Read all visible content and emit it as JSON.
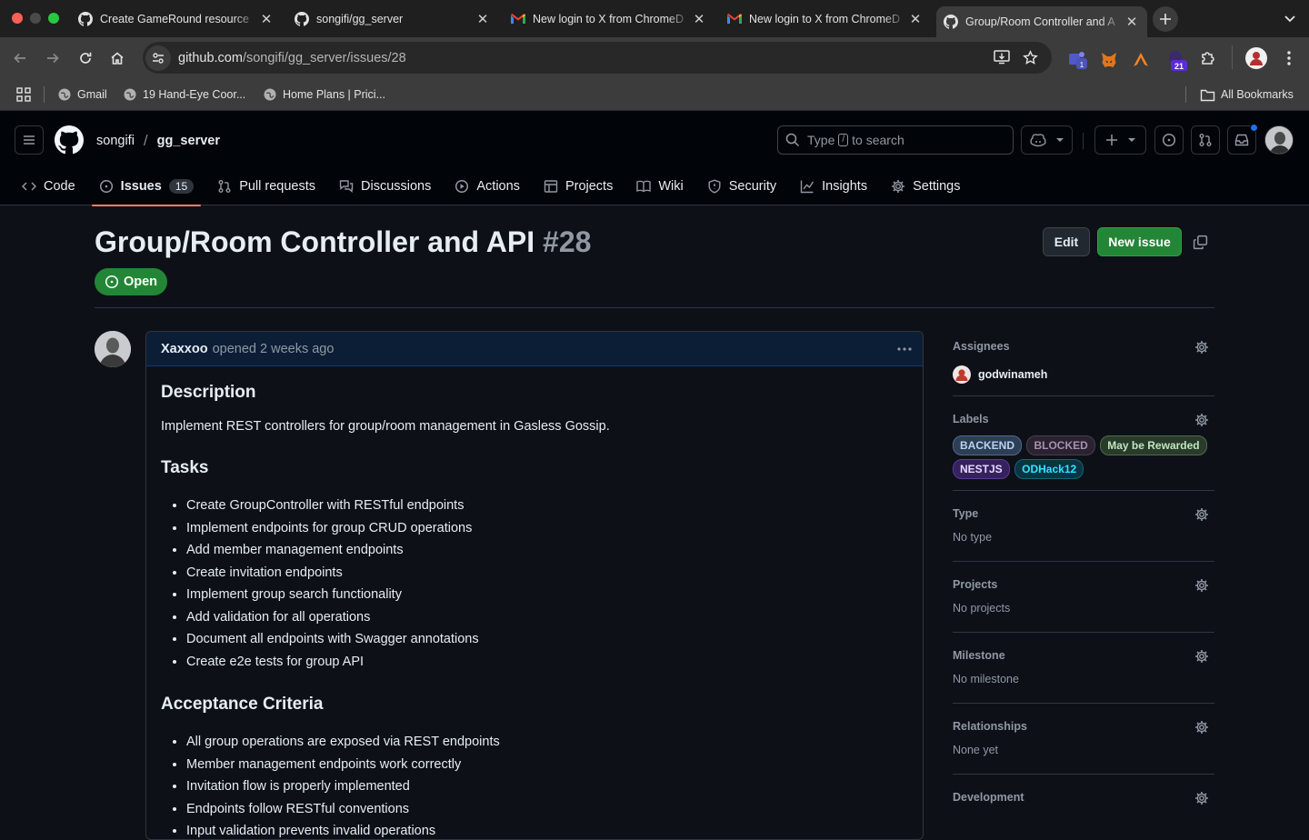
{
  "browser": {
    "tabs": [
      {
        "title": "Create GameRound resource",
        "icon": "github-icon"
      },
      {
        "title": "songifi/gg_server",
        "icon": "github-icon"
      },
      {
        "title": "New login to X from ChromeD",
        "icon": "gmail-icon"
      },
      {
        "title": "New login to X from ChromeD",
        "icon": "gmail-icon"
      },
      {
        "title": "Group/Room Controller and A",
        "icon": "github-icon",
        "active": true
      }
    ],
    "url_host": "github.com",
    "url_path": "/songifi/gg_server/issues/28",
    "extension_badges": {
      "teams": "1",
      "ext": "21"
    },
    "bookmarks": [
      {
        "label": "Gmail",
        "icon": "gmail-icon"
      },
      {
        "label": "19 Hand-Eye Coor...",
        "icon": "globe-icon"
      },
      {
        "label": "Home Plans | Prici...",
        "icon": "globe-icon"
      }
    ],
    "all_bookmarks": "All Bookmarks"
  },
  "repo": {
    "owner": "songifi",
    "separator": "/",
    "name": "gg_server"
  },
  "search": {
    "prefix": "Type",
    "kbd": "/",
    "suffix": "to search"
  },
  "nav": [
    {
      "label": "Code",
      "icon": "code-icon"
    },
    {
      "label": "Issues",
      "icon": "issue-opened-icon",
      "counter": "15",
      "selected": true
    },
    {
      "label": "Pull requests",
      "icon": "git-pull-request-icon"
    },
    {
      "label": "Discussions",
      "icon": "comment-discussion-icon"
    },
    {
      "label": "Actions",
      "icon": "play-icon"
    },
    {
      "label": "Projects",
      "icon": "table-icon"
    },
    {
      "label": "Wiki",
      "icon": "book-icon"
    },
    {
      "label": "Security",
      "icon": "shield-icon"
    },
    {
      "label": "Insights",
      "icon": "graph-icon"
    },
    {
      "label": "Settings",
      "icon": "gear-icon"
    }
  ],
  "issue": {
    "title": "Group/Room Controller and API",
    "number": "#28",
    "state": "Open",
    "edit_label": "Edit",
    "new_issue_label": "New issue",
    "author": "Xaxxoo",
    "opened_text": "opened 2 weeks ago",
    "body": {
      "h_description": "Description",
      "description": "Implement REST controllers for group/room management in Gasless Gossip.",
      "h_tasks": "Tasks",
      "tasks": [
        "Create GroupController with RESTful endpoints",
        "Implement endpoints for group CRUD operations",
        "Add member management endpoints",
        "Create invitation endpoints",
        "Implement group search functionality",
        "Add validation for all operations",
        "Document all endpoints with Swagger annotations",
        "Create e2e tests for group API"
      ],
      "h_acceptance": "Acceptance Criteria",
      "acceptance": [
        "All group operations are exposed via REST endpoints",
        "Member management endpoints work correctly",
        "Invitation flow is properly implemented",
        "Endpoints follow RESTful conventions",
        "Input validation prevents invalid operations"
      ]
    }
  },
  "sidebar": {
    "assignees": {
      "heading": "Assignees",
      "user": "godwinameh"
    },
    "labels": {
      "heading": "Labels",
      "items": [
        {
          "name": "BACKEND",
          "color": "#b8d2ef"
        },
        {
          "name": "BLOCKED",
          "color": "#a891b0"
        },
        {
          "name": "May be Rewarded",
          "color": "#bfe5bf"
        },
        {
          "name": "NESTJS",
          "color": "#d9c6ff"
        },
        {
          "name": "ODHack12",
          "color": "#2ee6ff"
        }
      ]
    },
    "type": {
      "heading": "Type",
      "value": "No type"
    },
    "projects": {
      "heading": "Projects",
      "value": "No projects"
    },
    "milestone": {
      "heading": "Milestone",
      "value": "No milestone"
    },
    "relationships": {
      "heading": "Relationships",
      "value": "None yet"
    },
    "development": {
      "heading": "Development"
    }
  }
}
